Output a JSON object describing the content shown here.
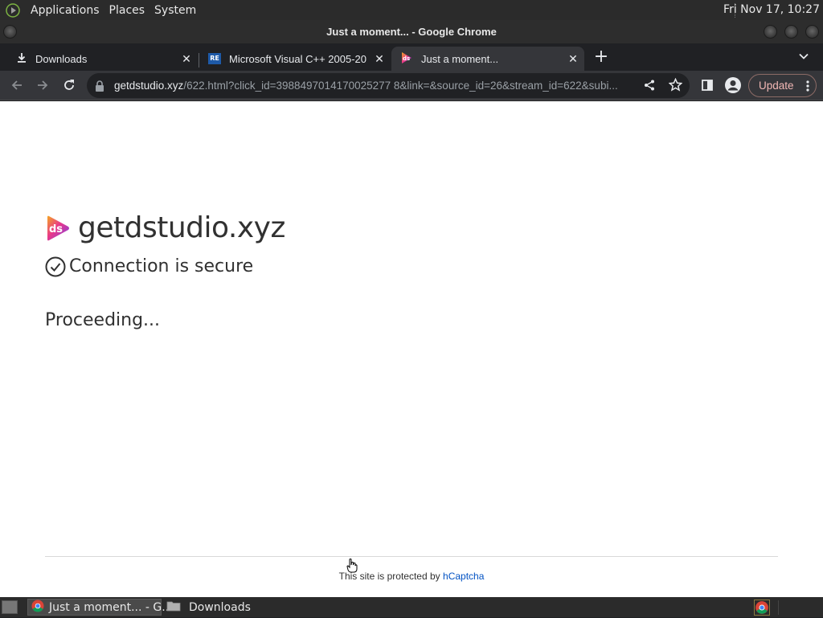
{
  "top_panel": {
    "menus": [
      "Applications",
      "Places",
      "System"
    ],
    "clock": "Fri Nov 17, 10:27"
  },
  "window": {
    "title": "Just a moment... - Google Chrome"
  },
  "tabs": [
    {
      "label": "Downloads",
      "icon": "download-icon",
      "active": false
    },
    {
      "label": "Microsoft Visual C++ 2005-20",
      "icon": "re-favicon",
      "active": false
    },
    {
      "label": "Just a moment...",
      "icon": "ds-favicon",
      "active": true
    }
  ],
  "toolbar": {
    "url_host": "getdstudio.xyz",
    "url_rest": "/622.html?click_id=3988497014170025277 8&link=&source_id=26&stream_id=622&subi...",
    "update_label": "Update"
  },
  "page": {
    "site_host": "getdstudio.xyz",
    "secure_text": "Connection is secure",
    "status_text": "Proceeding...",
    "footer_prefix": "This site is protected by",
    "footer_link": "hCaptcha"
  },
  "taskbar": {
    "items": [
      {
        "label": "Just a moment... - G...",
        "icon": "chrome-icon",
        "active": true
      },
      {
        "label": "Downloads",
        "icon": "folder-icon",
        "active": false
      }
    ]
  },
  "colors": {
    "logo_pink": "#e8388a",
    "logo_orange": "#f5a623",
    "link_blue": "#0051c3",
    "update_text": "#f2b8b5"
  }
}
